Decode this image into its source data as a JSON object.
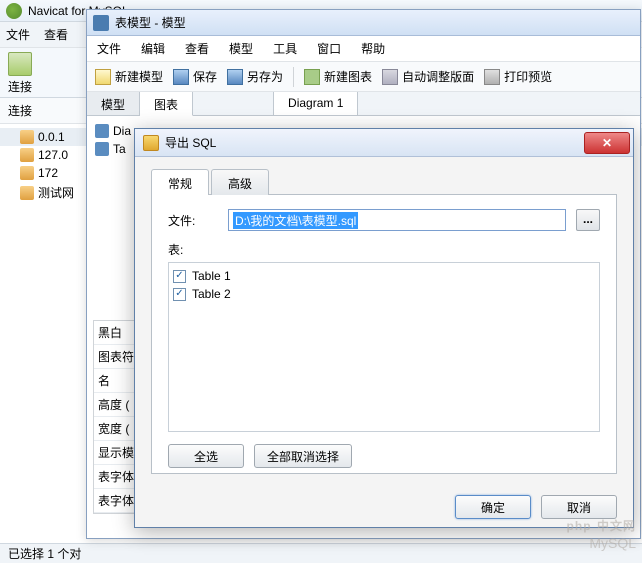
{
  "app": {
    "title": "Navicat for MySQL",
    "menu": [
      "文件",
      "查看"
    ],
    "toolbar_connect": "连接",
    "sidebar_label": "连接",
    "connections": [
      {
        "label": "0.0.1"
      },
      {
        "label": "127.0"
      },
      {
        "label": "172"
      },
      {
        "label": "测试网"
      }
    ],
    "status": "已选择 1 个对"
  },
  "model_window": {
    "title": "表模型 - 模型",
    "menu": [
      "文件",
      "编辑",
      "查看",
      "模型",
      "工具",
      "窗口",
      "帮助"
    ],
    "toolbar": {
      "new_model": "新建模型",
      "save": "保存",
      "save_as": "另存为",
      "new_chart": "新建图表",
      "auto_layout": "自动调整版面",
      "print_preview": "打印预览"
    },
    "tabs": {
      "model": "模型",
      "chart": "图表",
      "diagram": "Diagram 1"
    },
    "tree_items": [
      "Dia",
      "Ta"
    ],
    "props": [
      "黑白",
      "图表符",
      "名",
      "高度 (",
      "宽度 (",
      "显示模",
      "表字体",
      "表字体"
    ]
  },
  "dialog": {
    "title": "导出 SQL",
    "tabs": {
      "general": "常规",
      "advanced": "高级"
    },
    "file_label": "文件:",
    "file_value": "D:\\我的文档\\表模型.sql",
    "table_label": "表:",
    "tables": [
      {
        "name": "Table 1",
        "checked": true
      },
      {
        "name": "Table 2",
        "checked": true
      }
    ],
    "select_all": "全选",
    "deselect_all": "全部取消选择",
    "browse": "...",
    "ok": "确定",
    "cancel": "取消"
  },
  "watermark": {
    "top": "php",
    "mid": "中文网",
    "bottom": "MySQL"
  }
}
